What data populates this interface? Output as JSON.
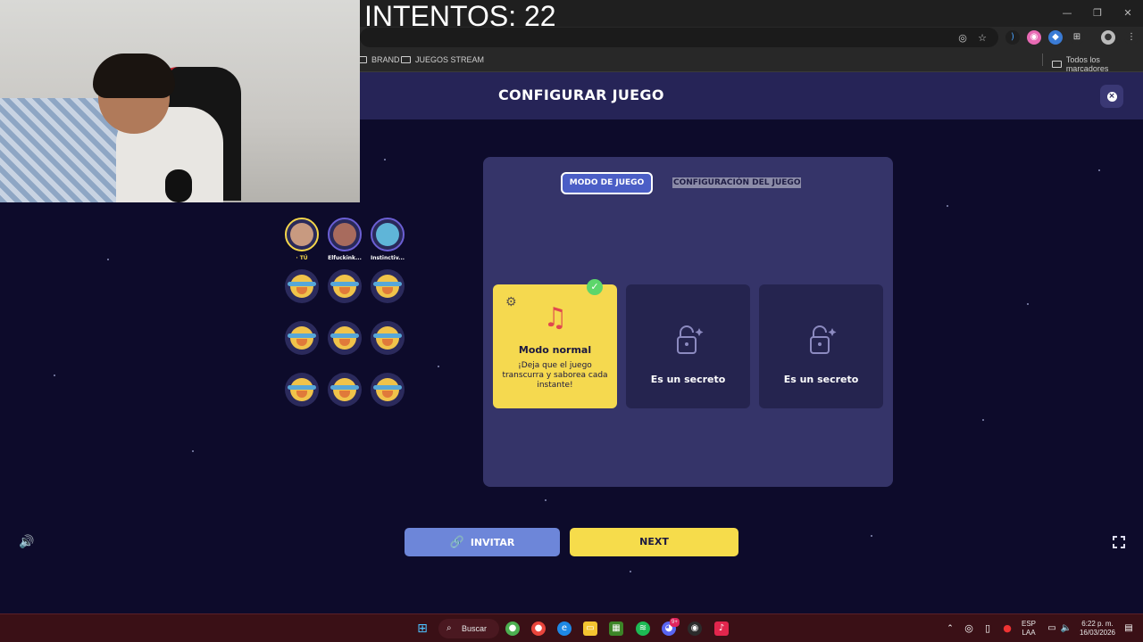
{
  "overlay": {
    "attempts_text": "INTENTOS: 22"
  },
  "browser": {
    "bookmarks": [
      {
        "label": "BRAND"
      },
      {
        "label": "JUEGOS STREAM"
      }
    ],
    "all_bookmarks_label": "Todos los marcadores",
    "window_controls": [
      "minimize",
      "restore",
      "close"
    ]
  },
  "header": {
    "title": "CONFIGURAR JUEGO"
  },
  "players": {
    "active": [
      {
        "name": "· TÚ"
      },
      {
        "name": "Elfuckink..."
      },
      {
        "name": "Instinctiv..."
      }
    ],
    "empty_slots": 9
  },
  "panel": {
    "tabs": [
      {
        "label": "MODO DE JUEGO",
        "active": true
      },
      {
        "label": "CONFIGURACIÓN DEL JUEGO",
        "active": false
      }
    ],
    "modes": [
      {
        "title": "Modo normal",
        "description": "¡Deja que el juego transcurra y saborea cada instante!",
        "selected": true,
        "icon": "music-notes-icon"
      },
      {
        "title": "Es un secreto",
        "selected": false,
        "icon": "lock-icon"
      },
      {
        "title": "Es un secreto",
        "selected": false,
        "icon": "lock-icon"
      }
    ]
  },
  "actions": {
    "invite_label": "INVITAR",
    "next_label": "NEXT"
  },
  "taskbar": {
    "search_label": "Buscar",
    "language": "ESP",
    "layout": "LAA",
    "time": "6:22 p. m.",
    "date": "16/03/2026",
    "discord_badge": "9+"
  },
  "colors": {
    "background": "#0d0b2b",
    "header": "#262457",
    "panel": "#353469",
    "accent_yellow": "#f6dc4b",
    "invite_blue": "#6d86d9",
    "tab_blue": "#4b5ec6"
  }
}
